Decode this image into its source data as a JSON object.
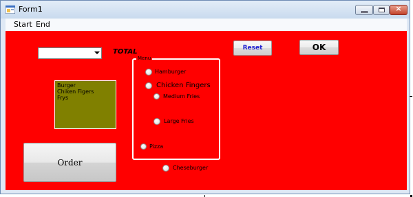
{
  "window": {
    "title": "Form1",
    "icon": "winforms-app-icon",
    "controls": {
      "minimize": "minimize-icon",
      "maximize": "maximize-icon",
      "close_symbol": "×"
    }
  },
  "menubar": {
    "items": [
      "Start",
      "End"
    ]
  },
  "form": {
    "background_color": "#ff0000",
    "combo_value": "",
    "total_label": "TOTAL",
    "order_list": {
      "background_color": "#808000",
      "items": [
        "Burger",
        "Chiken Figers",
        "Frys"
      ]
    },
    "order_button": "Order",
    "reset_button": "Reset",
    "ok_button": "OK",
    "menu_group": {
      "label": "Menu",
      "options": [
        {
          "label": "Hamburger",
          "checked": false
        },
        {
          "label": "Chicken Fingers",
          "checked": false
        },
        {
          "label": "Medium Fries",
          "checked": false
        },
        {
          "label": "Large Fries",
          "checked": false
        },
        {
          "label": "Pizza",
          "checked": false
        },
        {
          "label": "Cheseburger",
          "checked": false
        }
      ]
    }
  }
}
